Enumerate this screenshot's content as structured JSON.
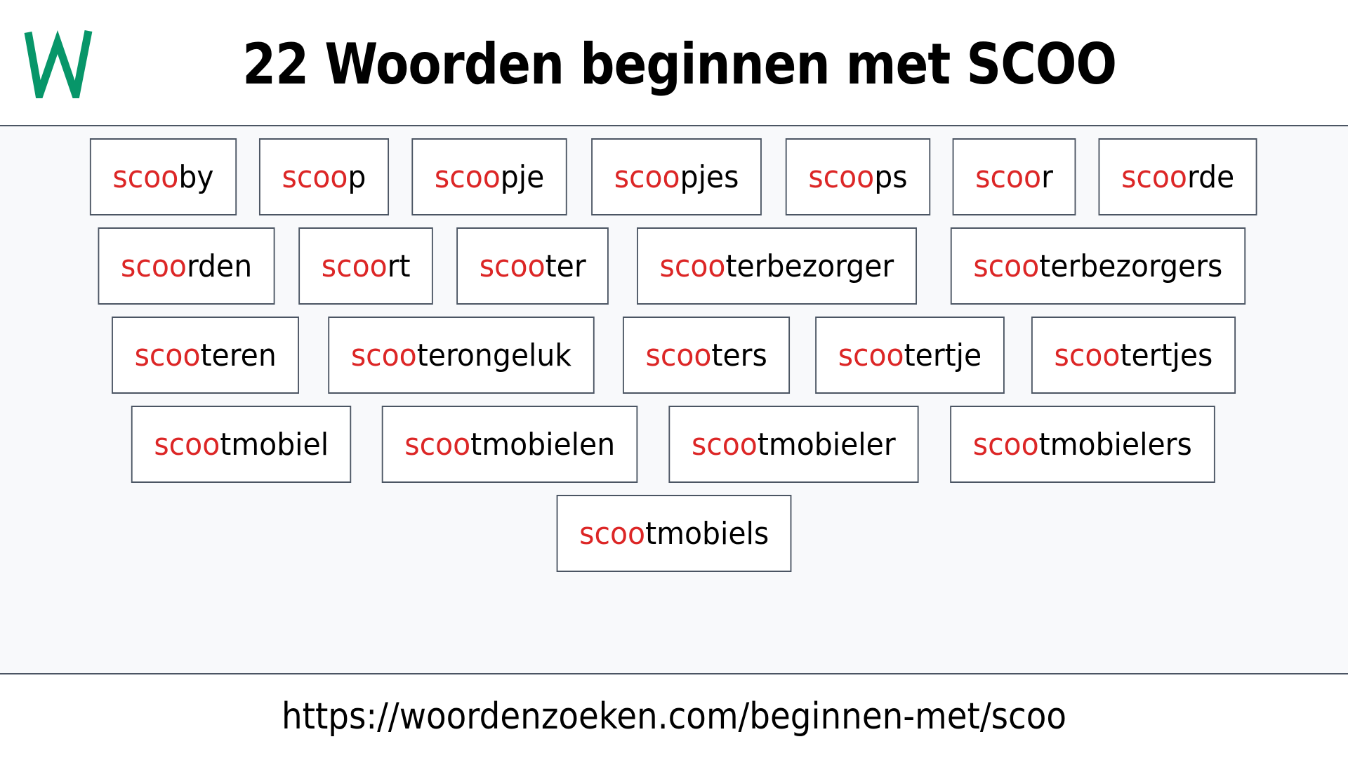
{
  "header": {
    "logo_letter": "W",
    "logo_color": "#079669",
    "title": "22 Woorden beginnen met SCOO"
  },
  "prefix": "scoo",
  "prefix_color": "#dc2626",
  "words": [
    {
      "prefix": "scoo",
      "rest": "by"
    },
    {
      "prefix": "scoo",
      "rest": "p"
    },
    {
      "prefix": "scoo",
      "rest": "pje"
    },
    {
      "prefix": "scoo",
      "rest": "pjes"
    },
    {
      "prefix": "scoo",
      "rest": "ps"
    },
    {
      "prefix": "scoo",
      "rest": "r"
    },
    {
      "prefix": "scoo",
      "rest": "rde"
    },
    {
      "prefix": "scoo",
      "rest": "rden"
    },
    {
      "prefix": "scoo",
      "rest": "rt"
    },
    {
      "prefix": "scoo",
      "rest": "ter"
    },
    {
      "prefix": "scoo",
      "rest": "terbezorger"
    },
    {
      "prefix": "scoo",
      "rest": "terbezorgers"
    },
    {
      "prefix": "scoo",
      "rest": "teren"
    },
    {
      "prefix": "scoo",
      "rest": "terongeluk"
    },
    {
      "prefix": "scoo",
      "rest": "ters"
    },
    {
      "prefix": "scoo",
      "rest": "tertje"
    },
    {
      "prefix": "scoo",
      "rest": "tertjes"
    },
    {
      "prefix": "scoo",
      "rest": "tmobiel"
    },
    {
      "prefix": "scoo",
      "rest": "tmobielen"
    },
    {
      "prefix": "scoo",
      "rest": "tmobieler"
    },
    {
      "prefix": "scoo",
      "rest": "tmobielers"
    },
    {
      "prefix": "scoo",
      "rest": "tmobiels"
    }
  ],
  "footer": {
    "url": "https://woordenzoeken.com/beginnen-met/scoo"
  }
}
